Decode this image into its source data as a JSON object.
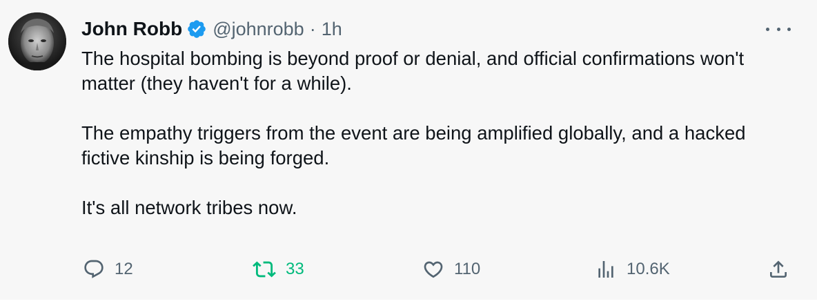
{
  "author": {
    "name": "John Robb",
    "handle": "@johnrobb",
    "separator": "·",
    "time": "1h",
    "verified": true,
    "verified_color": "#1d9bf0"
  },
  "tweet": {
    "paragraphs": [
      "The hospital bombing is beyond proof or denial, and official confirmations won't matter (they haven't for a while).",
      "The empathy triggers from the event are being amplified globally, and a hacked fictive kinship is being forged.",
      "It's all network tribes now."
    ]
  },
  "actions": {
    "reply": {
      "icon": "reply-icon",
      "count": "12"
    },
    "retweet": {
      "icon": "retweet-icon",
      "count": "33",
      "active": true,
      "color": "#00ba7c"
    },
    "like": {
      "icon": "heart-icon",
      "count": "110"
    },
    "views": {
      "icon": "views-icon",
      "count": "10.6K"
    },
    "share": {
      "icon": "share-icon"
    }
  },
  "more_icon": "more-dots-icon",
  "colors": {
    "text": "#0f1419",
    "secondary": "#536471",
    "background": "#f7f7f7"
  }
}
